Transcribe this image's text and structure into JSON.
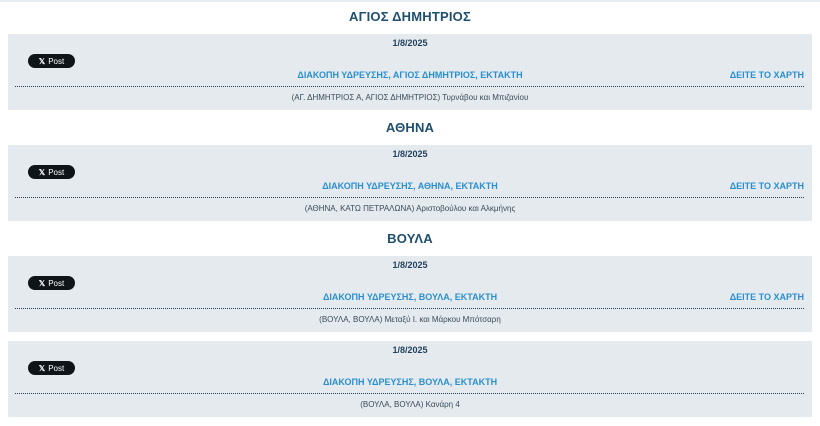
{
  "post_label": "Post",
  "map_label": "ΔΕΙΤΕ ΤΟ ΧΑΡΤΗ",
  "sections": [
    {
      "title": "ΑΓΙΟΣ ΔΗΜΗΤΡΙΟΣ",
      "items": [
        {
          "date": "1/8/2025",
          "title": "ΔΙΑΚΟΠΗ ΥΔΡΕΥΣΗΣ, ΑΓΙΟΣ ΔΗΜΗΤΡΙΟΣ, ΕΚΤΑΚΤΗ",
          "description": "(ΑΓ. ΔΗΜΗΤΡΙΟΣ Α, ΑΓΙΟΣ ΔΗΜΗΤΡΙΟΣ) Τυρνάβου και Μπιζανίου",
          "has_map": true
        }
      ]
    },
    {
      "title": "ΑΘΗΝΑ",
      "items": [
        {
          "date": "1/8/2025",
          "title": "ΔΙΑΚΟΠΗ ΥΔΡΕΥΣΗΣ, ΑΘΗΝΑ, ΕΚΤΑΚΤΗ",
          "description": "(ΑΘΗΝΑ, ΚΑΤΩ ΠΕΤΡΑΛΩΝΑ) Αριστοβούλου και Αλκμήνης",
          "has_map": true
        }
      ]
    },
    {
      "title": "ΒΟΥΛΑ",
      "items": [
        {
          "date": "1/8/2025",
          "title": "ΔΙΑΚΟΠΗ ΥΔΡΕΥΣΗΣ, ΒΟΥΛΑ, ΕΚΤΑΚΤΗ",
          "description": "(ΒΟΥΛΑ, ΒΟΥΛΑ) Μεταξύ Ι. και Μάρκου Μπότσαρη",
          "has_map": true
        },
        {
          "date": "1/8/2025",
          "title": "ΔΙΑΚΟΠΗ ΥΔΡΕΥΣΗΣ, ΒΟΥΛΑ, ΕΚΤΑΚΤΗ",
          "description": "(ΒΟΥΛΑ, ΒΟΥΛΑ) Κανάρη 4",
          "has_map": false
        }
      ]
    }
  ]
}
